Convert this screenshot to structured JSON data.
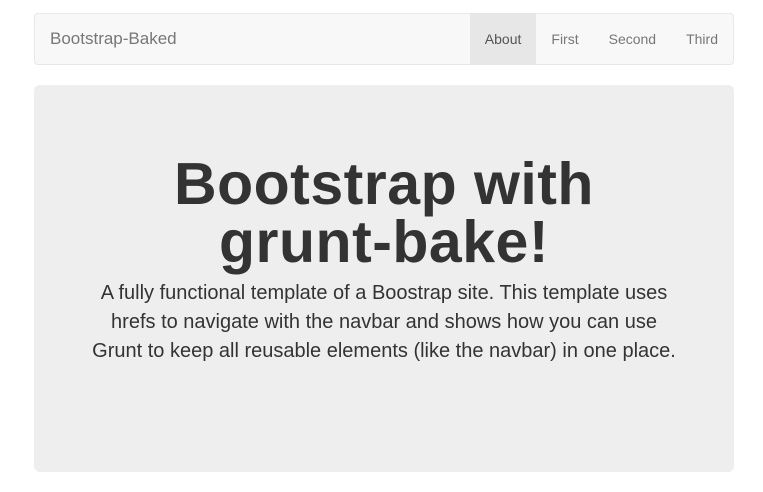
{
  "navbar": {
    "brand": "Bootstrap-Baked",
    "items": [
      {
        "label": "About",
        "active": true
      },
      {
        "label": "First",
        "active": false
      },
      {
        "label": "Second",
        "active": false
      },
      {
        "label": "Third",
        "active": false
      }
    ]
  },
  "jumbotron": {
    "heading": "Bootstrap with grunt-bake!",
    "lead": "A fully functional template of a Boostrap site. This template uses hrefs to navigate with the navbar and shows how you can use Grunt to keep all reusable elements (like the navbar) in one place."
  }
}
